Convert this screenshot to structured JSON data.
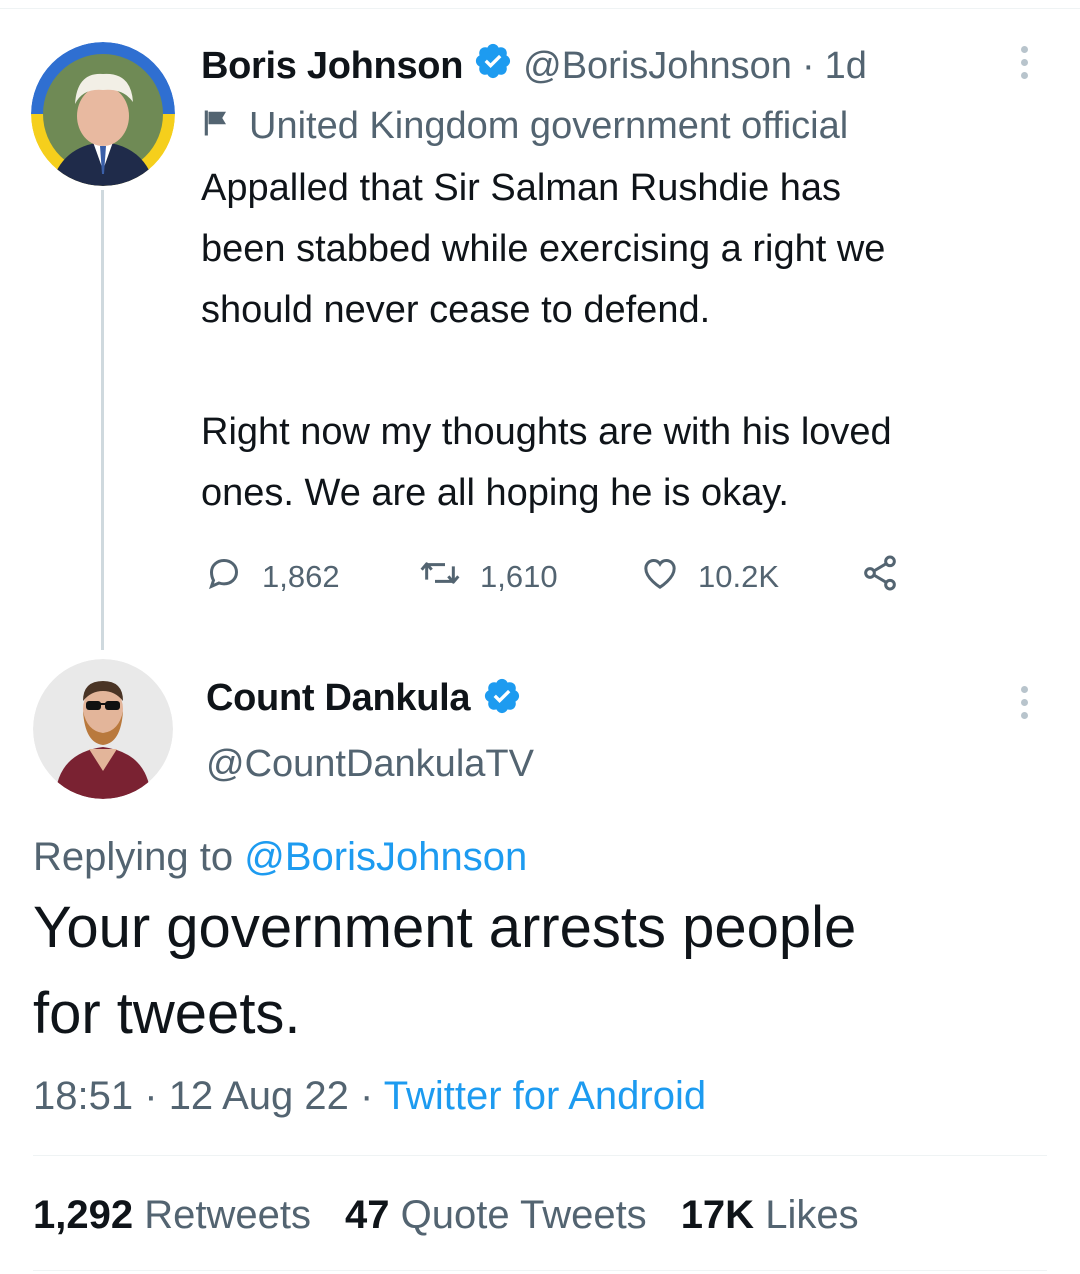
{
  "tweet": {
    "author_name": "Boris Johnson",
    "handle": "@BorisJohnson",
    "separator": "·",
    "age": "1d",
    "label": "United Kingdom government official",
    "text": "Appalled that Sir Salman Rushdie has\nbeen stabbed while exercising a right we\nshould never cease to defend.\n\nRight now my thoughts are with his loved\nones. We are all hoping he is okay.",
    "replies": "1,862",
    "retweets": "1,610",
    "likes": "10.2K"
  },
  "reply": {
    "author_name": "Count Dankula",
    "handle": "@CountDankulaTV",
    "replying_prefix": "Replying to",
    "replying_handle": "@BorisJohnson",
    "text": "Your government arrests people\nfor tweets.",
    "time": "18:51",
    "date": "12 Aug 22",
    "separator": "·",
    "source": "Twitter for Android",
    "stats": {
      "retweets_count": "1,292",
      "retweets_label": "Retweets",
      "quotes_count": "47",
      "quotes_label": "Quote Tweets",
      "likes_count": "17K",
      "likes_label": "Likes"
    }
  },
  "colors": {
    "accent": "#1d9bf0",
    "text": "#0f1419",
    "muted": "#536471",
    "ukraine_blue": "#2f6fd1",
    "ukraine_yellow": "#f5cf1c"
  }
}
